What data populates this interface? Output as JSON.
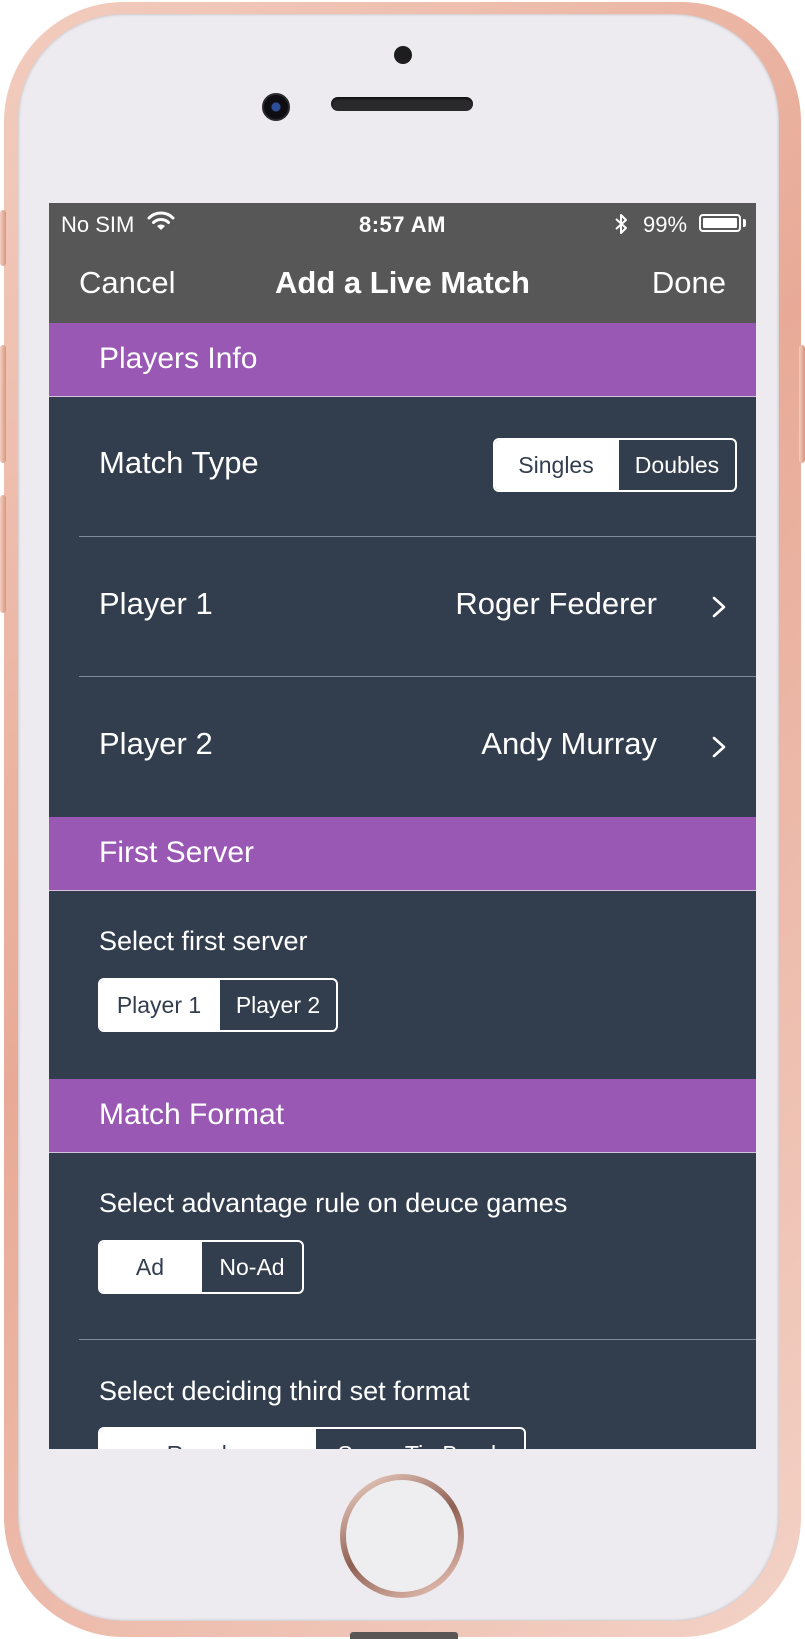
{
  "status_bar": {
    "carrier": "No SIM",
    "wifi_icon": "wifi-icon",
    "time": "8:57 AM",
    "bluetooth_icon": "bluetooth-icon",
    "battery_percent": "99%",
    "battery_level": 0.99
  },
  "nav": {
    "cancel_label": "Cancel",
    "title": "Add a Live Match",
    "done_label": "Done"
  },
  "players_info": {
    "header": "Players Info",
    "match_type": {
      "label": "Match Type",
      "options": [
        "Singles",
        "Doubles"
      ],
      "selected": "Singles"
    },
    "player1": {
      "label": "Player 1",
      "value": "Roger Federer"
    },
    "player2": {
      "label": "Player 2",
      "value": "Andy Murray"
    }
  },
  "first_server": {
    "header": "First Server",
    "prompt": "Select first server",
    "options": [
      "Player 1",
      "Player 2"
    ],
    "selected": "Player 1"
  },
  "match_format": {
    "header": "Match Format",
    "advantage_prompt": "Select advantage rule on deuce games",
    "advantage_options": [
      "Ad",
      "No-Ad"
    ],
    "advantage_selected": "Ad",
    "third_set_prompt": "Select deciding third set format",
    "third_set_options": [
      "Regular",
      "Super Tie Break"
    ],
    "third_set_selected": "Regular"
  },
  "colors": {
    "section_header": "#9858b3",
    "content_background": "#323e4e",
    "nav_background": "#575757"
  }
}
